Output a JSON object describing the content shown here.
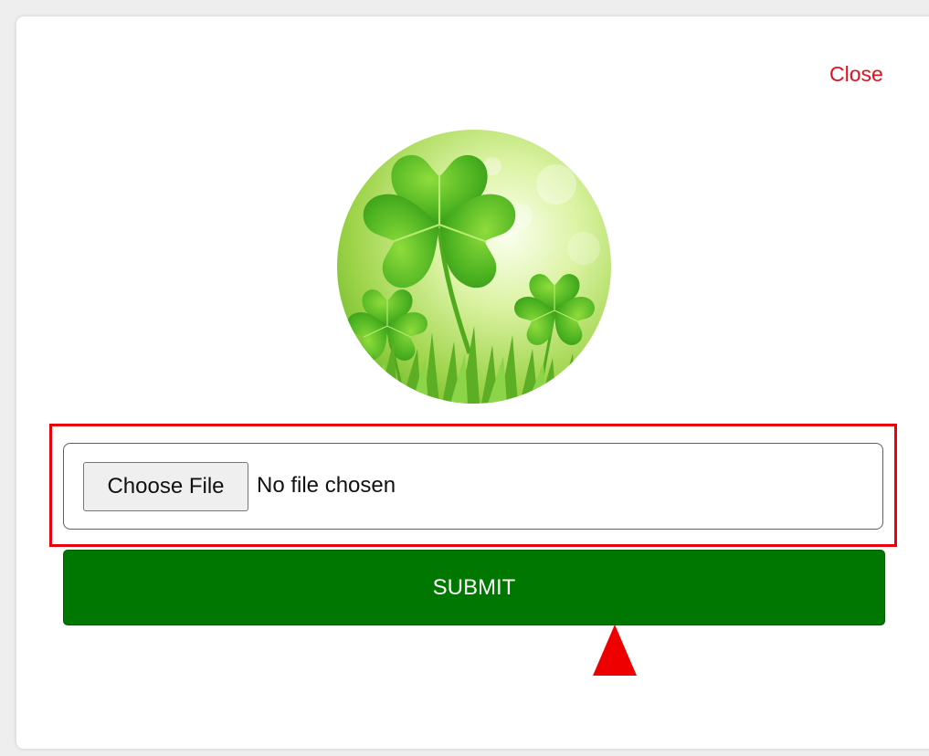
{
  "modal": {
    "close_label": "Close",
    "logo_icon": "shamrock-clover-image",
    "file_input": {
      "button_label": "Choose File",
      "status_text": "No file chosen"
    },
    "submit_label": "SUBMIT"
  },
  "colors": {
    "close_text": "#e3101e",
    "submit_bg": "#007700",
    "highlight": "#e8000a",
    "arrow": "#ee0000"
  }
}
